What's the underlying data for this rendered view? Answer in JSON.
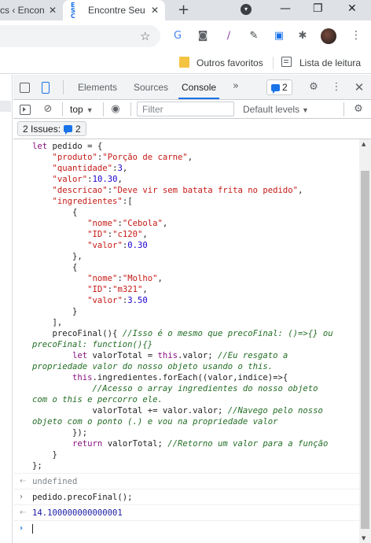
{
  "browser": {
    "tabs": [
      {
        "title": "cs ‹ Encon",
        "close": "✕"
      },
      {
        "title": "Encontre Seu",
        "favicon": "ES\nC",
        "close": "✕"
      }
    ],
    "new_tab": "+",
    "window_buttons": {
      "minimize": "—",
      "restore": "❐",
      "close": "✕"
    },
    "bookmark_star": "☆",
    "bookmarks": [
      {
        "label": "Outros favoritos",
        "icon": "folder-icon"
      },
      {
        "label": "Lista de leitura",
        "icon": "reading-list-icon"
      }
    ]
  },
  "devtools": {
    "tabs": [
      "Elements",
      "Sources",
      "Console"
    ],
    "active_tab": "Console",
    "more": "»",
    "issues_count": "2",
    "console_toolbar": {
      "context": "top",
      "filter_placeholder": "Filter",
      "levels": "Default levels"
    },
    "issues_bar": {
      "label": "2 Issues:",
      "count": "2"
    }
  },
  "console": {
    "code_lines": [
      [
        {
          "t": "let ",
          "c": "k"
        },
        {
          "t": "pedido = {",
          "c": "v"
        }
      ],
      [
        {
          "t": "    ",
          "c": "v"
        },
        {
          "t": "\"produto\"",
          "c": "s"
        },
        {
          "t": ":",
          "c": "v"
        },
        {
          "t": "\"Porção de carne\"",
          "c": "s"
        },
        {
          "t": ",",
          "c": "v"
        }
      ],
      [
        {
          "t": "    ",
          "c": "v"
        },
        {
          "t": "\"quantidade\"",
          "c": "s"
        },
        {
          "t": ":",
          "c": "v"
        },
        {
          "t": "3",
          "c": "n"
        },
        {
          "t": ",",
          "c": "v"
        }
      ],
      [
        {
          "t": "    ",
          "c": "v"
        },
        {
          "t": "\"valor\"",
          "c": "s"
        },
        {
          "t": ":",
          "c": "v"
        },
        {
          "t": "10.30",
          "c": "n"
        },
        {
          "t": ",",
          "c": "v"
        }
      ],
      [
        {
          "t": "    ",
          "c": "v"
        },
        {
          "t": "\"descricao\"",
          "c": "s"
        },
        {
          "t": ":",
          "c": "v"
        },
        {
          "t": "\"Deve vir sem batata frita no pedido\"",
          "c": "s"
        },
        {
          "t": ",",
          "c": "v"
        }
      ],
      [
        {
          "t": "    ",
          "c": "v"
        },
        {
          "t": "\"ingredientes\"",
          "c": "s"
        },
        {
          "t": ":[",
          "c": "v"
        }
      ],
      [
        {
          "t": "        {",
          "c": "v"
        }
      ],
      [
        {
          "t": "           ",
          "c": "v"
        },
        {
          "t": "\"nome\"",
          "c": "s"
        },
        {
          "t": ":",
          "c": "v"
        },
        {
          "t": "\"Cebola\"",
          "c": "s"
        },
        {
          "t": ",",
          "c": "v"
        }
      ],
      [
        {
          "t": "           ",
          "c": "v"
        },
        {
          "t": "\"ID\"",
          "c": "s"
        },
        {
          "t": ":",
          "c": "v"
        },
        {
          "t": "\"c120\"",
          "c": "s"
        },
        {
          "t": ",",
          "c": "v"
        }
      ],
      [
        {
          "t": "           ",
          "c": "v"
        },
        {
          "t": "\"valor\"",
          "c": "s"
        },
        {
          "t": ":",
          "c": "v"
        },
        {
          "t": "0.30",
          "c": "n"
        }
      ],
      [
        {
          "t": "        },",
          "c": "v"
        }
      ],
      [
        {
          "t": "        {",
          "c": "v"
        }
      ],
      [
        {
          "t": "           ",
          "c": "v"
        },
        {
          "t": "\"nome\"",
          "c": "s"
        },
        {
          "t": ":",
          "c": "v"
        },
        {
          "t": "\"Molho\"",
          "c": "s"
        },
        {
          "t": ",",
          "c": "v"
        }
      ],
      [
        {
          "t": "           ",
          "c": "v"
        },
        {
          "t": "\"ID\"",
          "c": "s"
        },
        {
          "t": ":",
          "c": "v"
        },
        {
          "t": "\"m321\"",
          "c": "s"
        },
        {
          "t": ",",
          "c": "v"
        }
      ],
      [
        {
          "t": "           ",
          "c": "v"
        },
        {
          "t": "\"valor\"",
          "c": "s"
        },
        {
          "t": ":",
          "c": "v"
        },
        {
          "t": "3.50",
          "c": "n"
        }
      ],
      [
        {
          "t": "        }",
          "c": "v"
        }
      ],
      [
        {
          "t": "    ],",
          "c": "v"
        }
      ],
      [
        {
          "t": "    precoFinal(){ ",
          "c": "v"
        },
        {
          "t": "//Isso é o mesmo que precoFinal: ()=>{} ou",
          "c": "c"
        }
      ],
      [
        {
          "t": "precoFinal: function(){}",
          "c": "c"
        }
      ],
      [
        {
          "t": "        ",
          "c": "v"
        },
        {
          "t": "let ",
          "c": "k"
        },
        {
          "t": "valorTotal = ",
          "c": "v"
        },
        {
          "t": "this",
          "c": "k"
        },
        {
          "t": ".valor; ",
          "c": "v"
        },
        {
          "t": "//Eu resgato a",
          "c": "c"
        }
      ],
      [
        {
          "t": "propriedade valor do nosso objeto usando o this.",
          "c": "c"
        }
      ],
      [
        {
          "t": "        ",
          "c": "v"
        },
        {
          "t": "this",
          "c": "k"
        },
        {
          "t": ".ingredientes.forEach((valor,indice)=>{",
          "c": "v"
        }
      ],
      [
        {
          "t": "            ",
          "c": "v"
        },
        {
          "t": "//Acesso o array ingredientes do nosso objeto",
          "c": "c"
        }
      ],
      [
        {
          "t": "com o this e percorro ele.",
          "c": "c"
        }
      ],
      [
        {
          "t": "            valorTotal += valor.valor; ",
          "c": "v"
        },
        {
          "t": "//Navego pelo nosso",
          "c": "c"
        }
      ],
      [
        {
          "t": "objeto com o ponto (.) e vou na propriedade valor",
          "c": "c"
        }
      ],
      [
        {
          "t": "        });",
          "c": "v"
        }
      ],
      [
        {
          "t": "        ",
          "c": "v"
        },
        {
          "t": "return ",
          "c": "k"
        },
        {
          "t": "valorTotal; ",
          "c": "v"
        },
        {
          "t": "//Retorno um valor para a função",
          "c": "c"
        }
      ],
      [
        {
          "t": "    }",
          "c": "v"
        }
      ],
      [
        {
          "t": "};",
          "c": "v"
        }
      ]
    ],
    "result_undefined": "undefined",
    "input_command": "pedido.precoFinal();",
    "result_value": "14.100000000000001",
    "result_arrow": "⇠",
    "input_arrow": "›"
  }
}
